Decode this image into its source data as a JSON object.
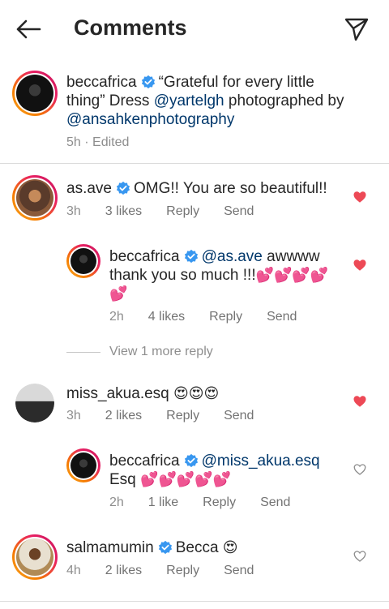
{
  "header": {
    "title": "Comments"
  },
  "caption": {
    "username": "beccafrica",
    "text_1": "“Grateful for every little",
    "text_2a": "thing” Dress ",
    "mention_1": "@yartelgh",
    "text_2b": " photographed by",
    "mention_2": "@ansahkenphotography",
    "meta": "5h · Edited"
  },
  "comments": [
    {
      "username": "as.ave",
      "text": "OMG!! You are so beautiful!!",
      "time": "3h",
      "likes": "3 likes",
      "reply": "Reply",
      "send": "Send",
      "liked": true
    },
    {
      "username": "beccafrica",
      "mention": "@as.ave",
      "text_1": " awwww",
      "text_2": "thank you so much !!!",
      "emoji_2": "💕💕💕💕",
      "emoji_3": "💕",
      "time": "2h",
      "likes": "4 likes",
      "reply": "Reply",
      "send": "Send",
      "liked": true
    },
    {
      "view_more": "View 1 more reply"
    },
    {
      "username": "miss_akua.esq",
      "emoji": "😍😍😍",
      "time": "3h",
      "likes": "2 likes",
      "reply": "Reply",
      "send": "Send",
      "liked": true
    },
    {
      "username": "beccafrica",
      "mention": "@miss_akua.esq",
      "text_2": "Esq ",
      "emoji_2": "💕💕💕💕💕",
      "time": "2h",
      "likes": "1 like",
      "reply": "Reply",
      "send": "Send",
      "liked": false
    },
    {
      "username": "salmamumin",
      "text": "Becca ",
      "emoji": "😍",
      "time": "4h",
      "likes": "2 likes",
      "reply": "Reply",
      "send": "Send",
      "liked": false
    }
  ],
  "colors": {
    "like_red": "#ed4956",
    "verified_blue": "#3897f0",
    "mention": "#00376b",
    "meta_gray": "#8e8e8e"
  },
  "icons": {
    "back": "arrow-left-icon",
    "send": "paper-plane-icon",
    "like": "heart-icon",
    "verified": "verified-badge-icon"
  }
}
